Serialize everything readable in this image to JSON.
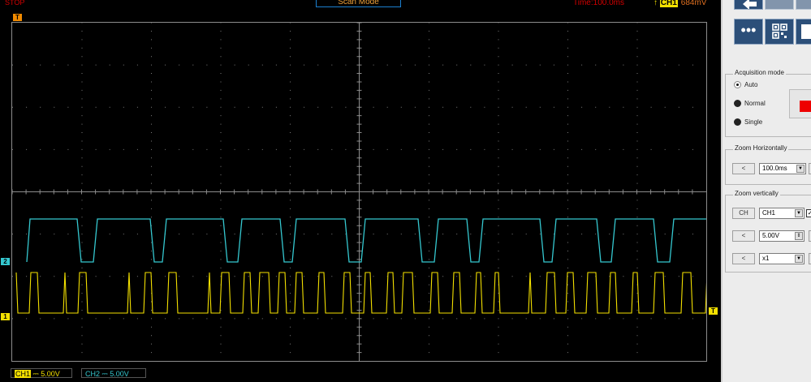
{
  "status": {
    "run_state": "STOP",
    "mode": "Scan Mode",
    "timebase": "Time:100.0ms",
    "trigger_channel": "CH1",
    "trigger_level": "684mV",
    "trigger_slope_glyph": "↑"
  },
  "markers": {
    "trigger_top": "T",
    "ch2": "2",
    "ch1": "1",
    "trigger_right": "T"
  },
  "channels": {
    "ch1": {
      "tag": "CH1",
      "coupling": "⎓",
      "volts": "5.00V",
      "color": "#f3e000"
    },
    "ch2": {
      "tag": "CH2",
      "coupling": "⎓",
      "volts": "5.00V",
      "color": "#35c8d0"
    }
  },
  "panel": {
    "more_icon": "•••",
    "acquisition": {
      "title": "Acquisition mode",
      "options": [
        "Auto",
        "Normal",
        "Single"
      ],
      "selected": "Auto"
    },
    "zoom_h": {
      "title": "Zoom Horizontally",
      "left_btn": "<",
      "value": "100.0ms"
    },
    "zoom_v": {
      "title": "Zoom vertically",
      "ch_btn": "CH",
      "ch_value": "CH1",
      "left_btn": "<",
      "volts": "5.00V",
      "probe": "x1"
    }
  }
}
